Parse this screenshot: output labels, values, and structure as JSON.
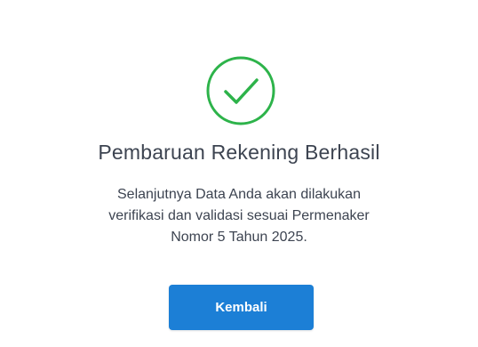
{
  "status": {
    "icon": "check-circle-icon",
    "color": "#2db34a"
  },
  "title": "Pembaruan Rekening Berhasil",
  "message_lines": [
    "Selanjutnya Data Anda akan dilakukan",
    "verifikasi dan validasi sesuai Permenaker",
    "Nomor 5 Tahun 2025."
  ],
  "button": {
    "label": "Kembali",
    "color": "#1c7fd6"
  }
}
